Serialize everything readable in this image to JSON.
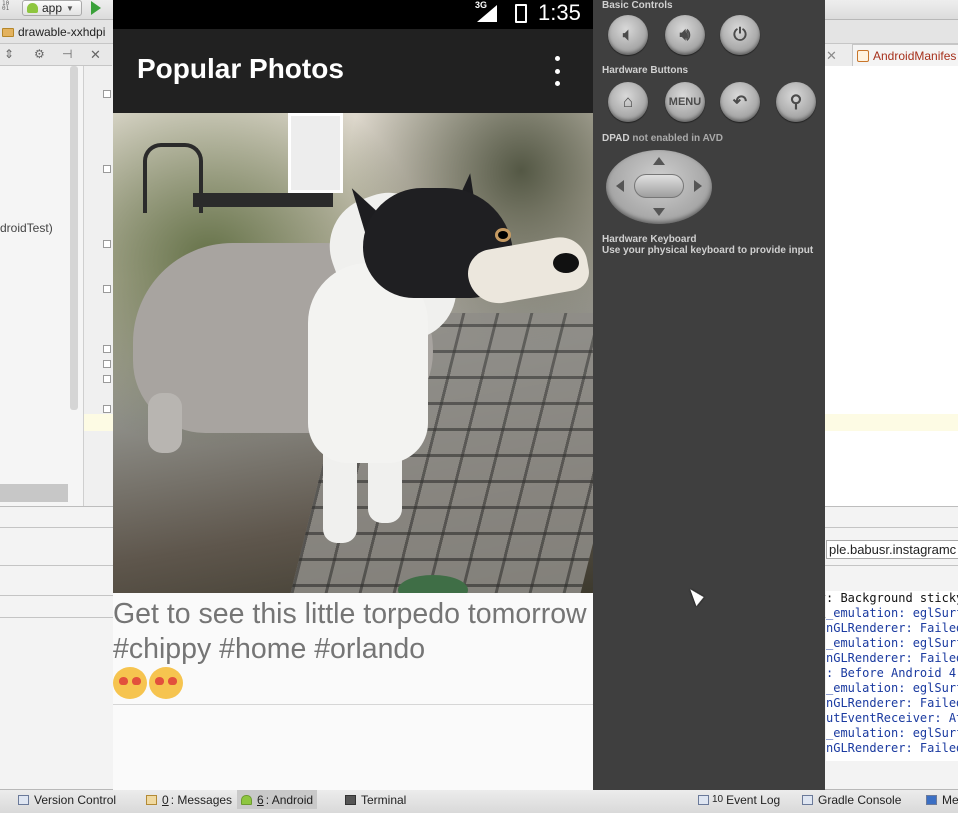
{
  "ide": {
    "run_config": "app",
    "file_tab": "drawable-xxhdpi",
    "manifest_tab": "AndroidManifes",
    "tree_fragment": "droidTest)",
    "package_field": "ple.babusr.instagramc",
    "logcat": [
      ": Background sticky",
      "_emulation: eglSurf",
      "nGLRenderer: Failed",
      "_emulation: eglSurf",
      "nGLRenderer: Failed",
      ": Before Android 4.",
      "_emulation: eglSurf",
      "nGLRenderer: Failed",
      "utEventReceiver: At",
      "_emulation: eglSurf",
      "nGLRenderer: Failed"
    ],
    "status_bar": {
      "version_control": "Version Control",
      "messages_num": "0",
      "messages": ": Messages",
      "android_num": "6",
      "android": ": Android",
      "terminal": "Terminal",
      "event_log_num": "10",
      "event_log": "Event Log",
      "gradle_console": "Gradle Console",
      "more": "Me"
    }
  },
  "phone": {
    "network": "3G",
    "time": "1:35",
    "app_title": "Popular Photos",
    "caption": "Get to see this little torpedo tomorrow #chippy #home #orlando",
    "caption_emoji": [
      "heart-eyes-emoji",
      "heart-eyes-emoji"
    ]
  },
  "control_panel": {
    "basic_controls": "Basic Controls",
    "hardware_buttons": "Hardware Buttons",
    "menu_label": "MENU",
    "dpad_label": "DPAD",
    "dpad_status": "not enabled in AVD",
    "keyboard_title": "Hardware Keyboard",
    "keyboard_hint": "Use your physical keyboard to provide input"
  },
  "colors": {
    "app_bar": "#212121",
    "status_bar": "#000000",
    "panel_bg": "#3f3f3f",
    "caption_text": "#757575",
    "manifest_tab_text": "#a6301b",
    "logcat_text": "#1a3aa0"
  }
}
